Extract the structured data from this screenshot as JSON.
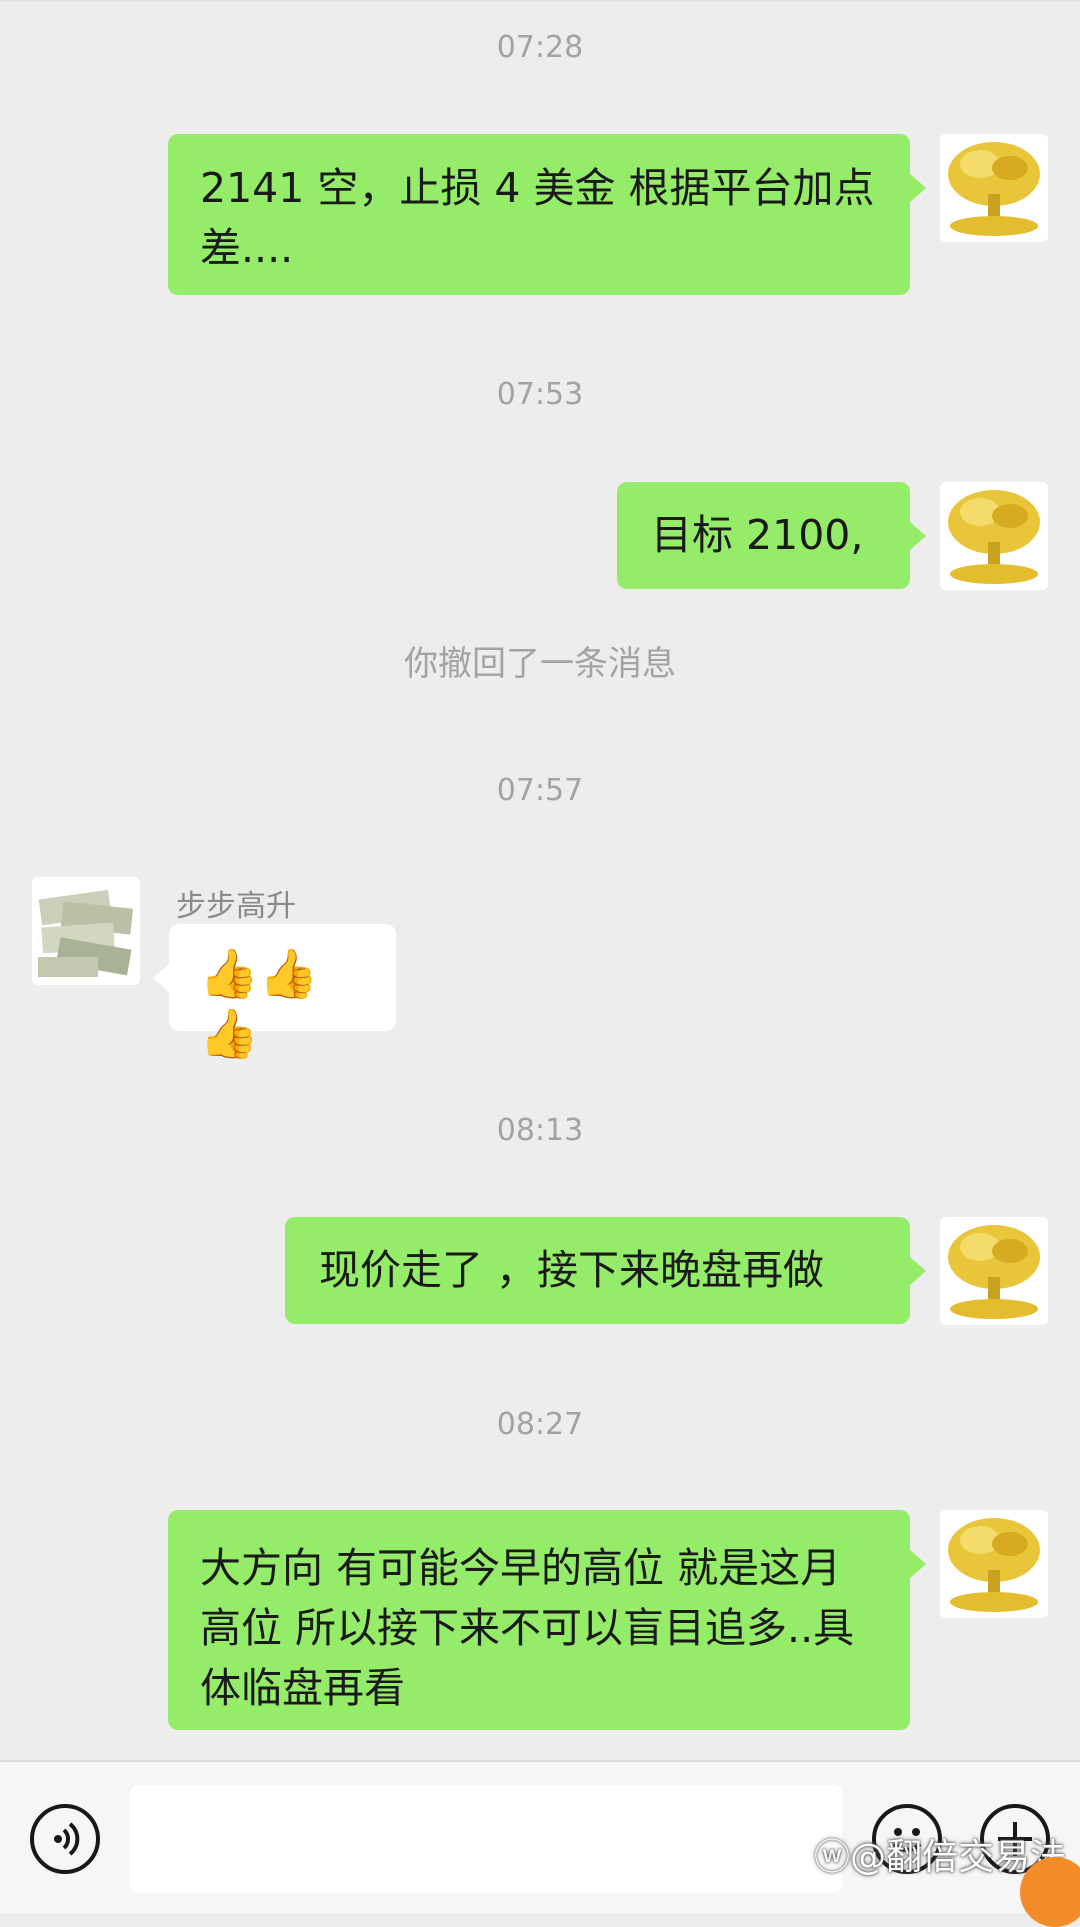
{
  "messages": [
    {
      "type": "time",
      "text": "07:28"
    },
    {
      "type": "outgoing",
      "text": "2141 空，止损 4 美金  根据平台加点差...."
    },
    {
      "type": "time",
      "text": "07:53"
    },
    {
      "type": "outgoing",
      "text": "目标 2100,"
    },
    {
      "type": "system",
      "text": "你撤回了一条消息"
    },
    {
      "type": "time",
      "text": "07:57"
    },
    {
      "type": "incoming",
      "sender": "步步高升",
      "text": "👍👍👍"
    },
    {
      "type": "time",
      "text": "08:13"
    },
    {
      "type": "outgoing",
      "text": "现价走了  ，接下来晚盘再做"
    },
    {
      "type": "time",
      "text": "08:27"
    },
    {
      "type": "outgoing",
      "text": "大方向  有可能今早的高位 就是这月高位  所以接下来不可以盲目追多..具体临盘再看"
    }
  ],
  "input_bar": {
    "voice_icon": "voice-icon",
    "emoji_icon": "emoji-icon",
    "more_icon": "plus-icon",
    "input_value": ""
  },
  "watermark": "@翻倍交易法",
  "colors": {
    "outgoing_bubble": "#95ec69",
    "incoming_bubble": "#ffffff",
    "background": "#ededed"
  }
}
